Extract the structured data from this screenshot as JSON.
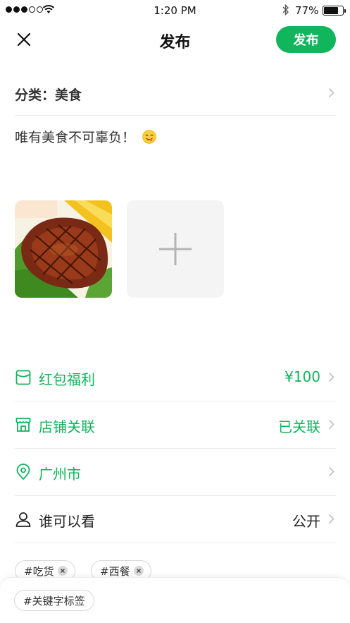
{
  "status_bar": {
    "time": "1:20 PM",
    "battery": "77%",
    "battery_level": 0.77
  },
  "nav": {
    "title": "发布",
    "publish_label": "发布",
    "close_icon": "close-icon"
  },
  "category": {
    "label": "分类：美食"
  },
  "post": {
    "text": "唯有美食不可辜负！",
    "emoji": "smiling-face-icon"
  },
  "media": {
    "photos": [
      {
        "name": "grilled-steak-photo"
      }
    ],
    "add_icon": "plus-icon"
  },
  "options": [
    {
      "key": "red-packet",
      "icon": "red-packet-icon",
      "label": "红包福利",
      "value": "¥100"
    },
    {
      "key": "store",
      "icon": "store-icon",
      "label": "店铺关联",
      "value": "已关联"
    },
    {
      "key": "location",
      "icon": "location-pin-icon",
      "label": "广州市",
      "value": ""
    },
    {
      "key": "visibility",
      "icon": "user-icon",
      "label": "谁可以看",
      "value": "公开"
    }
  ],
  "tags": [
    {
      "label": "#吃货"
    },
    {
      "label": "#西餐"
    }
  ],
  "keyword_tag": {
    "label": "#关键字标签"
  },
  "colors": {
    "accent": "#10b55c",
    "divider": "#ececec",
    "text": "#222222"
  }
}
